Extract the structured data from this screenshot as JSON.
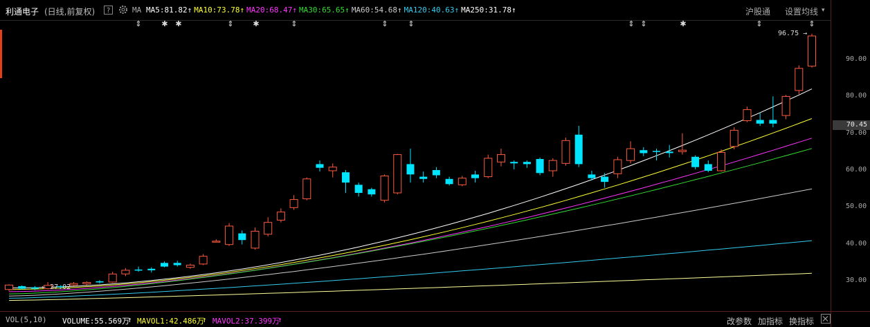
{
  "header": {
    "stock_name": "利通电子",
    "period_label": "(日线,前复权)",
    "help_label": "?",
    "ma_label": "MA",
    "ma_items": [
      {
        "text": "MA5:81.82",
        "color": "#ffffff"
      },
      {
        "text": "MA10:73.78",
        "color": "#ffff33"
      },
      {
        "text": "MA20:68.47",
        "color": "#ff33ff"
      },
      {
        "text": "MA30:65.65",
        "color": "#33dd33"
      },
      {
        "text": "MA60:54.68",
        "color": "#cccccc"
      },
      {
        "text": "MA120:40.63",
        "color": "#33ccee"
      },
      {
        "text": "MA250:31.78",
        "color": "#ffffff"
      }
    ],
    "arrow": "↑",
    "hgt_label": "沪股通",
    "settings_label": "设置均线",
    "settings_caret": "▾"
  },
  "axis": {
    "ticks": [
      "90.00",
      "80.00",
      "70.00",
      "60.00",
      "50.00",
      "40.00",
      "30.00"
    ],
    "current_price": "70.45"
  },
  "annotations": {
    "high": "96.75",
    "high_arrow": "→",
    "low_arrow": "←",
    "low": "27.02"
  },
  "volume_bar": {
    "title": "VOL(5,10)",
    "volume": "VOLUME:55.569万",
    "mavol1": "MAVOL1:42.486万",
    "mavol2": "MAVOL2:37.399万",
    "arrow": "↑",
    "buttons": [
      "改参数",
      "加指标",
      "换指标"
    ]
  },
  "colors": {
    "up": "#ff5a40",
    "down": "#00e5ff",
    "accent": "#e2401c"
  },
  "chart_data": {
    "type": "candlestick",
    "y_scale_ticks": [
      30,
      40,
      50,
      60,
      70,
      80,
      90
    ],
    "markers": [
      "⇕",
      "✱",
      "✱",
      "⇕",
      "✱",
      "⇕",
      "⇕",
      "⇕",
      "⇕",
      "⇕",
      "✱",
      "⇕",
      "⇕"
    ],
    "candles": [
      [
        27.4,
        28.6,
        27.0,
        28.8,
        "up"
      ],
      [
        28.3,
        27.6,
        27.4,
        28.5,
        "down"
      ],
      [
        28.0,
        27.6,
        27.2,
        28.3,
        "down"
      ],
      [
        27.6,
        28.5,
        27.4,
        29.4,
        "up"
      ],
      [
        28.3,
        28.0,
        27.6,
        28.6,
        "down"
      ],
      [
        28.6,
        29.0,
        28.4,
        29.4,
        "up"
      ],
      [
        28.9,
        29.3,
        28.6,
        29.6,
        "up"
      ],
      [
        29.6,
        29.3,
        29.0,
        29.9,
        "down"
      ],
      [
        29.4,
        31.6,
        29.2,
        32.2,
        "up"
      ],
      [
        31.6,
        32.6,
        31.0,
        33.2,
        "up"
      ],
      [
        32.6,
        32.8,
        32.2,
        33.6,
        "down"
      ],
      [
        33.0,
        32.6,
        32.0,
        33.4,
        "down"
      ],
      [
        34.6,
        33.6,
        33.4,
        35.0,
        "down"
      ],
      [
        34.6,
        34.0,
        33.6,
        35.2,
        "down"
      ],
      [
        33.4,
        34.0,
        33.0,
        34.4,
        "up"
      ],
      [
        34.3,
        36.4,
        34.0,
        37.0,
        "up"
      ],
      [
        40.5,
        40.5,
        40.5,
        41.0,
        "up"
      ],
      [
        39.6,
        44.6,
        39.2,
        45.4,
        "up"
      ],
      [
        42.6,
        40.8,
        39.6,
        43.4,
        "down"
      ],
      [
        38.6,
        43.2,
        38.2,
        44.2,
        "up"
      ],
      [
        42.4,
        45.6,
        41.8,
        47.0,
        "up"
      ],
      [
        46.2,
        48.4,
        45.6,
        49.4,
        "up"
      ],
      [
        49.6,
        51.8,
        49.0,
        53.0,
        "up"
      ],
      [
        52.0,
        57.4,
        51.6,
        57.8,
        "up"
      ],
      [
        61.4,
        60.4,
        59.4,
        62.4,
        "down"
      ],
      [
        59.6,
        60.6,
        57.8,
        61.6,
        "up"
      ],
      [
        59.2,
        56.4,
        53.6,
        59.8,
        "down"
      ],
      [
        55.8,
        53.6,
        52.6,
        56.4,
        "down"
      ],
      [
        54.6,
        53.2,
        52.6,
        55.0,
        "down"
      ],
      [
        51.6,
        58.2,
        51.0,
        58.6,
        "up"
      ],
      [
        53.6,
        64.0,
        53.2,
        64.2,
        "up"
      ],
      [
        61.4,
        58.6,
        56.4,
        65.6,
        "down"
      ],
      [
        58.0,
        57.4,
        56.4,
        59.4,
        "down"
      ],
      [
        59.8,
        58.4,
        57.6,
        60.6,
        "down"
      ],
      [
        57.4,
        56.0,
        55.6,
        58.0,
        "down"
      ],
      [
        55.8,
        57.6,
        55.4,
        58.2,
        "up"
      ],
      [
        58.6,
        57.6,
        56.4,
        59.6,
        "down"
      ],
      [
        58.0,
        63.0,
        57.6,
        64.0,
        "up"
      ],
      [
        62.0,
        64.0,
        60.8,
        65.6,
        "up"
      ],
      [
        62.0,
        61.6,
        60.0,
        62.4,
        "down"
      ],
      [
        62.0,
        61.4,
        60.4,
        62.4,
        "down"
      ],
      [
        62.8,
        59.0,
        58.4,
        63.2,
        "down"
      ],
      [
        59.6,
        62.4,
        58.0,
        63.0,
        "up"
      ],
      [
        61.6,
        67.8,
        61.0,
        68.6,
        "up"
      ],
      [
        69.4,
        61.4,
        60.6,
        71.8,
        "down"
      ],
      [
        58.6,
        57.6,
        57.0,
        59.6,
        "down"
      ],
      [
        58.0,
        56.6,
        55.0,
        59.0,
        "down"
      ],
      [
        58.8,
        62.6,
        57.6,
        63.4,
        "up"
      ],
      [
        62.4,
        65.6,
        61.6,
        67.6,
        "up"
      ],
      [
        65.2,
        64.4,
        63.6,
        66.0,
        "down"
      ],
      [
        65.0,
        64.8,
        62.4,
        65.6,
        "down"
      ],
      [
        64.8,
        64.4,
        63.2,
        66.6,
        "down"
      ],
      [
        64.8,
        65.2,
        64.0,
        69.8,
        "up"
      ],
      [
        63.4,
        60.6,
        60.0,
        63.8,
        "down"
      ],
      [
        61.4,
        59.6,
        59.2,
        62.4,
        "down"
      ],
      [
        59.6,
        64.6,
        59.4,
        65.4,
        "up"
      ],
      [
        66.2,
        70.6,
        65.4,
        71.4,
        "up"
      ],
      [
        73.2,
        76.2,
        72.8,
        77.0,
        "up"
      ],
      [
        73.4,
        72.4,
        71.8,
        75.4,
        "down"
      ],
      [
        73.4,
        72.4,
        71.4,
        79.8,
        "down"
      ],
      [
        74.6,
        79.8,
        73.6,
        80.2,
        "up"
      ],
      [
        81.4,
        87.4,
        80.4,
        88.2,
        "up"
      ],
      [
        88.0,
        96.2,
        87.6,
        96.8,
        "up"
      ]
    ],
    "ma_series": [
      {
        "name": "MA5",
        "color": "#ffffff",
        "start": 27.8,
        "end": 81.82
      },
      {
        "name": "MA10",
        "color": "#ffff33",
        "start": 27.4,
        "end": 73.78
      },
      {
        "name": "MA20",
        "color": "#ff33ff",
        "start": 26.8,
        "end": 68.47
      },
      {
        "name": "MA30",
        "color": "#33dd33",
        "start": 26.2,
        "end": 65.65
      },
      {
        "name": "MA60",
        "color": "#cccccc",
        "start": 25.6,
        "end": 54.68
      },
      {
        "name": "MA120",
        "color": "#33ccee",
        "start": 25.0,
        "end": 40.63
      },
      {
        "name": "MA250",
        "color": "#ffff99",
        "start": 24.4,
        "end": 31.78
      }
    ]
  }
}
